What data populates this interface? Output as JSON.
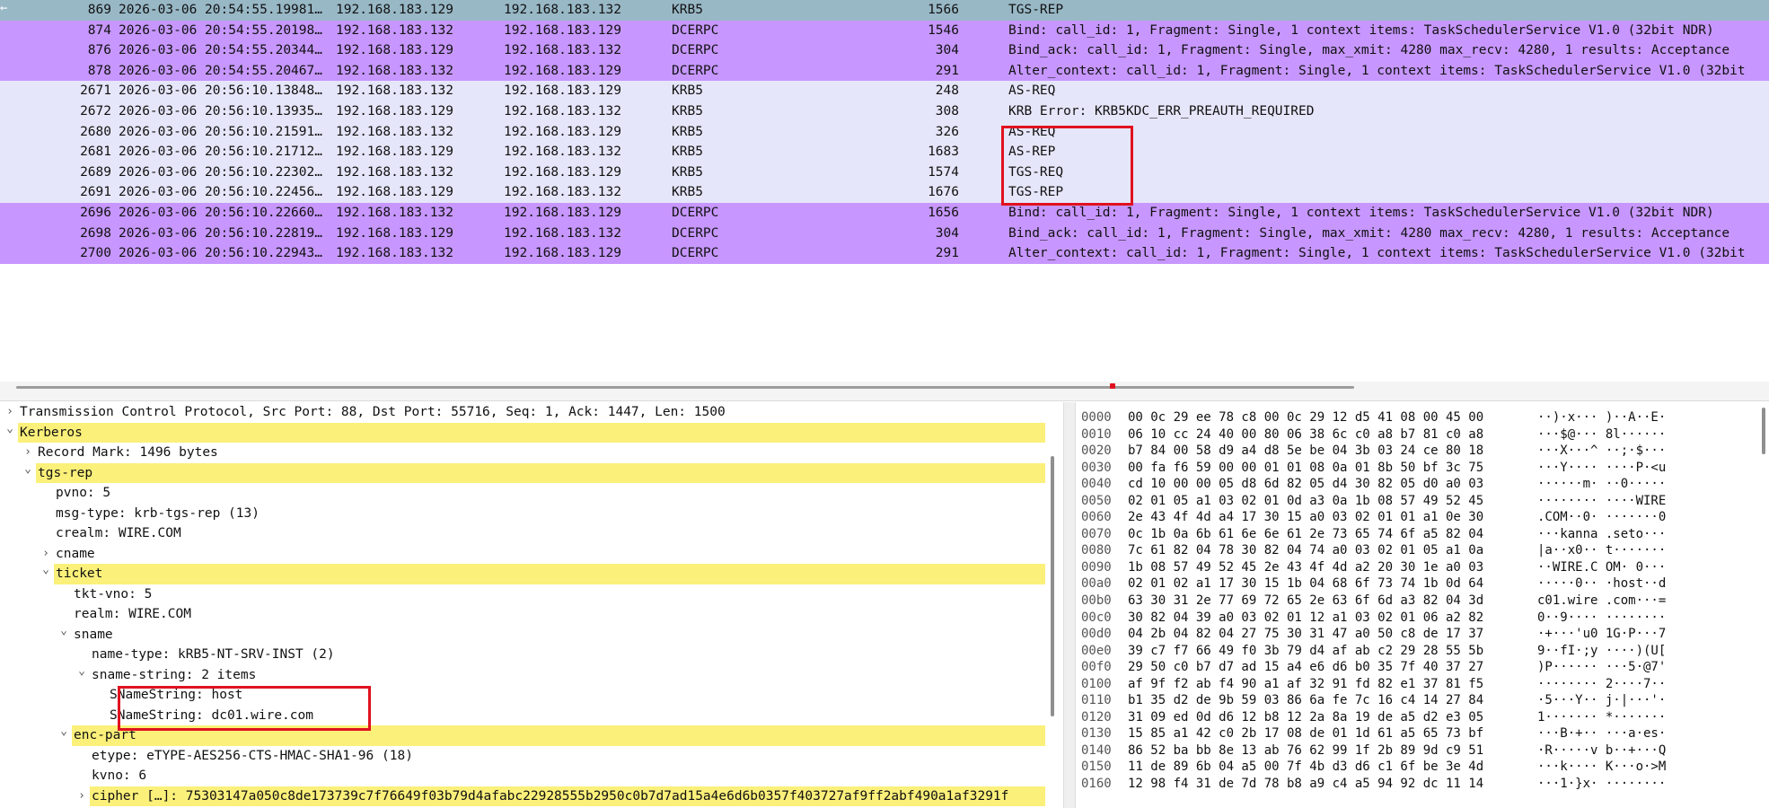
{
  "packets": [
    {
      "no": "869",
      "time": "2026-03-06 20:54:55.19981…",
      "src": "192.168.183.129",
      "dst": "192.168.183.132",
      "proto": "KRB5",
      "len": "1566",
      "info": "TGS-REP",
      "style": "selected"
    },
    {
      "no": "874",
      "time": "2026-03-06 20:54:55.20198…",
      "src": "192.168.183.132",
      "dst": "192.168.183.129",
      "proto": "DCERPC",
      "len": "1546",
      "info": "Bind: call_id: 1, Fragment: Single, 1 context items: TaskSchedulerService V1.0 (32bit NDR)",
      "style": "dcerpc"
    },
    {
      "no": "876",
      "time": "2026-03-06 20:54:55.20344…",
      "src": "192.168.183.129",
      "dst": "192.168.183.132",
      "proto": "DCERPC",
      "len": "304",
      "info": "Bind_ack: call_id: 1, Fragment: Single, max_xmit: 4280 max_recv: 4280, 1 results: Acceptance",
      "style": "dcerpc"
    },
    {
      "no": "878",
      "time": "2026-03-06 20:54:55.20467…",
      "src": "192.168.183.132",
      "dst": "192.168.183.129",
      "proto": "DCERPC",
      "len": "291",
      "info": "Alter_context: call_id: 1, Fragment: Single, 1 context items: TaskSchedulerService V1.0 (32bit",
      "style": "dcerpc"
    },
    {
      "no": "2671",
      "time": "2026-03-06 20:56:10.13848…",
      "src": "192.168.183.132",
      "dst": "192.168.183.129",
      "proto": "KRB5",
      "len": "248",
      "info": "AS-REQ",
      "style": "krb"
    },
    {
      "no": "2672",
      "time": "2026-03-06 20:56:10.13935…",
      "src": "192.168.183.129",
      "dst": "192.168.183.132",
      "proto": "KRB5",
      "len": "308",
      "info": "KRB Error: KRB5KDC_ERR_PREAUTH_REQUIRED",
      "style": "krb"
    },
    {
      "no": "2680",
      "time": "2026-03-06 20:56:10.21591…",
      "src": "192.168.183.132",
      "dst": "192.168.183.129",
      "proto": "KRB5",
      "len": "326",
      "info": "AS-REQ",
      "style": "krb"
    },
    {
      "no": "2681",
      "time": "2026-03-06 20:56:10.21712…",
      "src": "192.168.183.129",
      "dst": "192.168.183.132",
      "proto": "KRB5",
      "len": "1683",
      "info": "AS-REP",
      "style": "krb"
    },
    {
      "no": "2689",
      "time": "2026-03-06 20:56:10.22302…",
      "src": "192.168.183.132",
      "dst": "192.168.183.129",
      "proto": "KRB5",
      "len": "1574",
      "info": "TGS-REQ",
      "style": "krb"
    },
    {
      "no": "2691",
      "time": "2026-03-06 20:56:10.22456…",
      "src": "192.168.183.129",
      "dst": "192.168.183.132",
      "proto": "KRB5",
      "len": "1676",
      "info": "TGS-REP",
      "style": "krb"
    },
    {
      "no": "2696",
      "time": "2026-03-06 20:56:10.22660…",
      "src": "192.168.183.132",
      "dst": "192.168.183.129",
      "proto": "DCERPC",
      "len": "1656",
      "info": "Bind: call_id: 1, Fragment: Single, 1 context items: TaskSchedulerService V1.0 (32bit NDR)",
      "style": "dcerpc"
    },
    {
      "no": "2698",
      "time": "2026-03-06 20:56:10.22819…",
      "src": "192.168.183.129",
      "dst": "192.168.183.132",
      "proto": "DCERPC",
      "len": "304",
      "info": "Bind_ack: call_id: 1, Fragment: Single, max_xmit: 4280 max_recv: 4280, 1 results: Acceptance",
      "style": "dcerpc"
    },
    {
      "no": "2700",
      "time": "2026-03-06 20:56:10.22943…",
      "src": "192.168.183.132",
      "dst": "192.168.183.129",
      "proto": "DCERPC",
      "len": "291",
      "info": "Alter_context: call_id: 1, Fragment: Single, 1 context items: TaskSchedulerService V1.0 (32bit",
      "style": "dcerpc"
    }
  ],
  "details": [
    {
      "level": 0,
      "arrow": "collapsed",
      "text": "Transmission Control Protocol, Src Port: 88, Dst Port: 55716, Seq: 1, Ack: 1447, Len: 1500",
      "hl": false
    },
    {
      "level": 0,
      "arrow": "expanded",
      "text": "Kerberos",
      "hl": true
    },
    {
      "level": 1,
      "arrow": "collapsed",
      "text": "Record Mark: 1496 bytes",
      "hl": false
    },
    {
      "level": 1,
      "arrow": "expanded",
      "text": "tgs-rep",
      "hl": true
    },
    {
      "level": 2,
      "arrow": "none",
      "text": "pvno: 5",
      "hl": false
    },
    {
      "level": 2,
      "arrow": "none",
      "text": "msg-type: krb-tgs-rep (13)",
      "hl": false
    },
    {
      "level": 2,
      "arrow": "none",
      "text": "crealm: WIRE.COM",
      "hl": false
    },
    {
      "level": 2,
      "arrow": "collapsed",
      "text": "cname",
      "hl": false
    },
    {
      "level": 2,
      "arrow": "expanded",
      "text": "ticket",
      "hl": true
    },
    {
      "level": 3,
      "arrow": "none",
      "text": "tkt-vno: 5",
      "hl": false
    },
    {
      "level": 3,
      "arrow": "none",
      "text": "realm: WIRE.COM",
      "hl": false
    },
    {
      "level": 3,
      "arrow": "expanded",
      "text": "sname",
      "hl": false
    },
    {
      "level": 4,
      "arrow": "none",
      "text": "name-type: kRB5-NT-SRV-INST (2)",
      "hl": false
    },
    {
      "level": 4,
      "arrow": "expanded",
      "text": "sname-string: 2 items",
      "hl": false
    },
    {
      "level": 5,
      "arrow": "none",
      "text": "SNameString: host",
      "hl": false
    },
    {
      "level": 5,
      "arrow": "none",
      "text": "SNameString: dc01.wire.com",
      "hl": false
    },
    {
      "level": 3,
      "arrow": "expanded",
      "text": "enc-part",
      "hl": true
    },
    {
      "level": 4,
      "arrow": "none",
      "text": "etype: eTYPE-AES256-CTS-HMAC-SHA1-96 (18)",
      "hl": false
    },
    {
      "level": 4,
      "arrow": "none",
      "text": "kvno: 6",
      "hl": false
    },
    {
      "level": 4,
      "arrow": "collapsed",
      "text": "cipher […]: 75303147a050c8de173739c7f76649f03b79d4afabc22928555b2950c0b7d7ad15a4e6d6b0357f403727af9ff2abf490a1af3291f",
      "hl": true
    }
  ],
  "hex": [
    {
      "off": "0000",
      "bytes": "00 0c 29 ee 78 c8 00 0c  29 12 d5 41 08 00 45 00",
      "ascii": "··)·x··· )··A··E·"
    },
    {
      "off": "0010",
      "bytes": "06 10 cc 24 40 00 80 06  38 6c c0 a8 b7 81 c0 a8",
      "ascii": "···$@··· 8l······"
    },
    {
      "off": "0020",
      "bytes": "b7 84 00 58 d9 a4 d8 5e  be 04 3b 03 24 ce 80 18",
      "ascii": "···X···^ ··;·$···"
    },
    {
      "off": "0030",
      "bytes": "00 fa f6 59 00 00 01 01  08 0a 01 8b 50 bf 3c 75",
      "ascii": "···Y···· ····P·<u"
    },
    {
      "off": "0040",
      "bytes": "cd 10 00 00 05 d8 6d 82  05 d4 30 82 05 d0 a0 03",
      "ascii": "······m· ··0·····"
    },
    {
      "off": "0050",
      "bytes": "02 01 05 a1 03 02 01 0d  a3 0a 1b 08 57 49 52 45",
      "ascii": "········ ····WIRE"
    },
    {
      "off": "0060",
      "bytes": "2e 43 4f 4d a4 17 30 15  a0 03 02 01 01 a1 0e 30",
      "ascii": ".COM··0· ·······0"
    },
    {
      "off": "0070",
      "bytes": "0c 1b 0a 6b 61 6e 6e 61  2e 73 65 74 6f a5 82 04",
      "ascii": "···kanna .seto···"
    },
    {
      "off": "0080",
      "bytes": "7c 61 82 04 78 30 82 04  74 a0 03 02 01 05 a1 0a",
      "ascii": "|a··x0·· t·······"
    },
    {
      "off": "0090",
      "bytes": "1b 08 57 49 52 45 2e 43  4f 4d a2 20 30 1e a0 03",
      "ascii": "··WIRE.C OM· 0···"
    },
    {
      "off": "00a0",
      "bytes": "02 01 02 a1 17 30 15 1b  04 68 6f 73 74 1b 0d 64",
      "ascii": "·····0·· ·host··d"
    },
    {
      "off": "00b0",
      "bytes": "63 30 31 2e 77 69 72 65  2e 63 6f 6d a3 82 04 3d",
      "ascii": "c01.wire .com···="
    },
    {
      "off": "00c0",
      "bytes": "30 82 04 39 a0 03 02 01  12 a1 03 02 01 06 a2 82",
      "ascii": "0··9···· ········"
    },
    {
      "off": "00d0",
      "bytes": "04 2b 04 82 04 27 75 30  31 47 a0 50 c8 de 17 37",
      "ascii": "·+···'u0 1G·P···7"
    },
    {
      "off": "00e0",
      "bytes": "39 c7 f7 66 49 f0 3b 79  d4 af ab c2 29 28 55 5b",
      "ascii": "9··fI·;y ····)(U["
    },
    {
      "off": "00f0",
      "bytes": "29 50 c0 b7 d7 ad 15 a4  e6 d6 b0 35 7f 40 37 27",
      "ascii": ")P······ ···5·@7'"
    },
    {
      "off": "0100",
      "bytes": "af 9f f2 ab f4 90 a1 af  32 91 fd 82 e1 37 81 f5",
      "ascii": "········ 2····7··"
    },
    {
      "off": "0110",
      "bytes": "b1 35 d2 de 9b 59 03 86  6a fe 7c 16 c4 14 27 84",
      "ascii": "·5···Y·· j·|···'·"
    },
    {
      "off": "0120",
      "bytes": "31 09 ed 0d d6 12 b8 12  2a 8a 19 de a5 d2 e3 05",
      "ascii": "1······· *·······"
    },
    {
      "off": "0130",
      "bytes": "15 85 a1 42 c0 2b 17 08  de 01 1d 61 a5 65 73 bf",
      "ascii": "···B·+·· ···a·es·"
    },
    {
      "off": "0140",
      "bytes": "86 52 ba bb 8e 13 ab 76  62 99 1f 2b 89 9d c9 51",
      "ascii": "·R·····v b··+···Q"
    },
    {
      "off": "0150",
      "bytes": "11 de 89 6b 04 a5 00 7f  4b d3 d6 c1 6f be 3e 4d",
      "ascii": "···k···· K···o·>M"
    },
    {
      "off": "0160",
      "bytes": "12 98 f4 31 de 7d 78 b8  a9 c4 a5 94 92 dc 11 14",
      "ascii": "···1·}x· ········"
    }
  ],
  "colors": {
    "selected": "#98b8c6",
    "dcerpc": "#c797ff",
    "krb": "#e6e6fa",
    "highlight_box": "#e0111f",
    "tree_highlight": "#fbf07a"
  },
  "icons": {
    "expanded": "chevron-down-icon",
    "collapsed": "chevron-right-icon"
  }
}
